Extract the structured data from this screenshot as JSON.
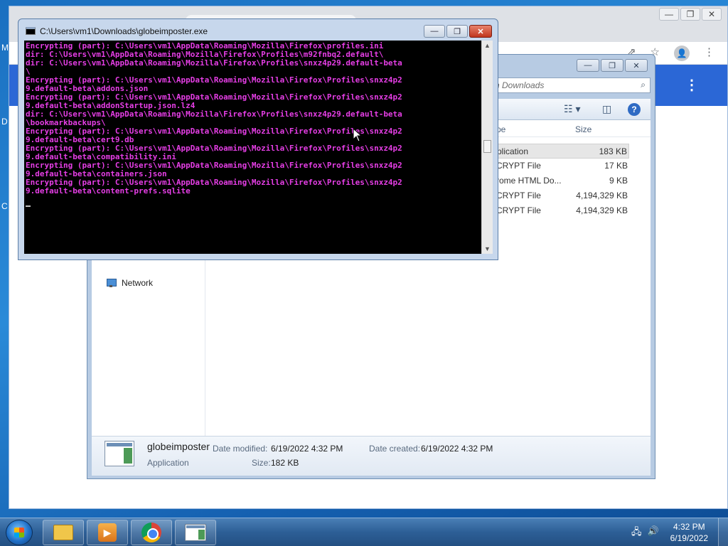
{
  "desktop": {
    "edge_letters": [
      "M",
      "D",
      "C"
    ]
  },
  "chrome": {
    "window_buttons": [
      "—",
      "❐",
      "✕"
    ],
    "icons": [
      "share-icon",
      "star-icon",
      "profile-icon",
      "menu-icon"
    ]
  },
  "explorer": {
    "window_buttons": [
      "—",
      "❐",
      "✕"
    ],
    "search_placeholder": "Search Downloads",
    "search_visible_text": "ch Downloads",
    "columns": {
      "type": "pe",
      "size": "Size"
    },
    "files": [
      {
        "type": "plication",
        "size": "183 KB",
        "selected": true
      },
      {
        "type": "CRYPT File",
        "size": "17 KB"
      },
      {
        "type": "rome HTML Do...",
        "size": "9 KB"
      },
      {
        "type": "CRYPT File",
        "size": "4,194,329 KB"
      },
      {
        "type": "CRYPT File",
        "size": "4,194,329 KB"
      }
    ],
    "nav_network": "Network",
    "details": {
      "name": "globeimposter",
      "type": "Application",
      "date_modified_label": "Date modified:",
      "date_modified": "6/19/2022 4:32 PM",
      "date_created_label": "Date created:",
      "date_created": "6/19/2022 4:32 PM",
      "size_label": "Size:",
      "size": "182 KB"
    }
  },
  "console": {
    "title": "C:\\Users\\vm1\\Downloads\\globeimposter.exe",
    "window_buttons": [
      "—",
      "❐",
      "✕"
    ],
    "lines": [
      "Encrypting (part): C:\\Users\\vm1\\AppData\\Roaming\\Mozilla\\Firefox\\profiles.ini",
      "dir: C:\\Users\\vm1\\AppData\\Roaming\\Mozilla\\Firefox\\Profiles\\m92fnbq2.default\\",
      "dir: C:\\Users\\vm1\\AppData\\Roaming\\Mozilla\\Firefox\\Profiles\\snxz4p29.default-beta",
      "\\",
      "Encrypting (part): C:\\Users\\vm1\\AppData\\Roaming\\Mozilla\\Firefox\\Profiles\\snxz4p2",
      "9.default-beta\\addons.json",
      "Encrypting (part): C:\\Users\\vm1\\AppData\\Roaming\\Mozilla\\Firefox\\Profiles\\snxz4p2",
      "9.default-beta\\addonStartup.json.lz4",
      "dir: C:\\Users\\vm1\\AppData\\Roaming\\Mozilla\\Firefox\\Profiles\\snxz4p29.default-beta",
      "\\bookmarkbackups\\",
      "Encrypting (part): C:\\Users\\vm1\\AppData\\Roaming\\Mozilla\\Firefox\\Profiles\\snxz4p2",
      "9.default-beta\\cert9.db",
      "Encrypting (part): C:\\Users\\vm1\\AppData\\Roaming\\Mozilla\\Firefox\\Profiles\\snxz4p2",
      "9.default-beta\\compatibility.ini",
      "Encrypting (part): C:\\Users\\vm1\\AppData\\Roaming\\Mozilla\\Firefox\\Profiles\\snxz4p2",
      "9.default-beta\\containers.json",
      "Encrypting (part): C:\\Users\\vm1\\AppData\\Roaming\\Mozilla\\Firefox\\Profiles\\snxz4p2",
      "9.default-beta\\content-prefs.sqlite"
    ]
  },
  "taskbar": {
    "apps": [
      "start-button",
      "file-explorer",
      "media-player",
      "google-chrome",
      "globeimposter"
    ],
    "time": "4:32 PM",
    "date": "6/19/2022"
  },
  "colors": {
    "console_text": "#e63ee6",
    "console_bg": "#000000",
    "chrome_blue": "#2b67d6",
    "taskbar": "#2d5f96"
  }
}
